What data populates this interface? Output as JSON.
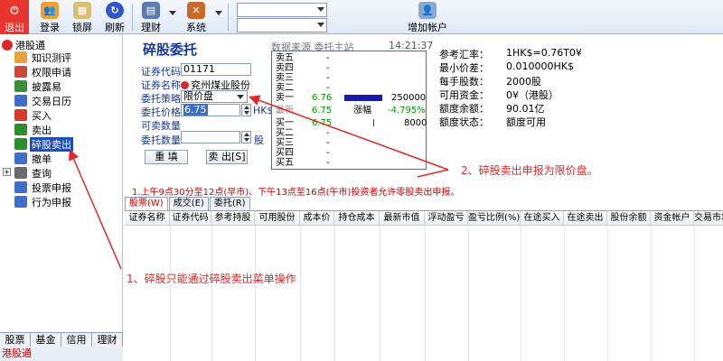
{
  "toolbar": {
    "exit": "退出",
    "login": "登录",
    "lock": "锁屏",
    "refresh": "刷新",
    "finance": "理财",
    "system": "系统",
    "add_account": "增加帐户"
  },
  "sidebar": {
    "root": "港股通",
    "items": [
      {
        "label": "知识测评",
        "color": "#e8a43c"
      },
      {
        "label": "权限申请",
        "color": "#c94a3b"
      },
      {
        "label": "披露易",
        "color": "#3b8f3b"
      },
      {
        "label": "交易日历",
        "color": "#3d6ec9"
      },
      {
        "label": "买入",
        "color": "#d63a2b"
      },
      {
        "label": "卖出",
        "color": "#2b8f2b"
      },
      {
        "label": "碎股卖出",
        "color": "#2b8f2b"
      },
      {
        "label": "撤单",
        "color": "#3d6ec9"
      },
      {
        "label": "查询",
        "color": "#6a6a6a"
      },
      {
        "label": "投票申报",
        "color": "#3d6ec9"
      },
      {
        "label": "行为申报",
        "color": "#3d6ec9"
      }
    ],
    "tabs": [
      "股票",
      "基金",
      "信用",
      "理财"
    ],
    "footer": "港股通"
  },
  "form": {
    "title": "碎股委托",
    "code_label": "证券代码",
    "code_value": "01171",
    "name_label": "证券名称",
    "name_value": "兖州煤业股份",
    "strategy_label": "委托策略",
    "strategy_value": "限价盘",
    "price_label": "委托价格",
    "price_value": "6.75",
    "price_unit": "HK$",
    "sellable_label": "可卖数量",
    "qty_label": "委托数量",
    "qty_unit": "股",
    "reset_btn": "重 填",
    "sell_btn": "卖 出[S]"
  },
  "quote": {
    "source_label": "数据来源",
    "source_value": "委托主站",
    "time": "14:21:37",
    "sell_labels": [
      "卖五",
      "卖四",
      "卖三",
      "卖二",
      "卖一"
    ],
    "sell_prices": [
      "-",
      "-",
      "-",
      "-",
      "6.76"
    ],
    "sell_qty": [
      "",
      "",
      "",
      "",
      "250000"
    ],
    "last_label": "最新",
    "last_price": "6.75",
    "change_label": "涨幅",
    "change_value": "-4.795%",
    "buy_labels": [
      "买一",
      "买二",
      "买三",
      "买四",
      "买五"
    ],
    "buy_prices": [
      "6.75",
      "-",
      "-",
      "-",
      "-"
    ],
    "buy_qty": [
      "8000",
      "",
      "",
      "",
      ""
    ]
  },
  "account": {
    "labels": [
      "参考汇率：",
      "最小价差：",
      "每手股数：",
      "可用资金：",
      "额度余额：",
      "额度状态："
    ],
    "values": [
      "1HK$=0.76T0¥",
      "0.010000HK$",
      "2000股",
      "0¥（港股）",
      "90.01亿",
      "额度可用"
    ]
  },
  "notice": "1.上午9点30分至12点(早市)、下午13点至16点(午市)投资者允许零股卖出申报。",
  "bottom_tabs": [
    "股票(W)",
    "成交(E)",
    "委托(R)"
  ],
  "grid_columns": [
    "证券名称",
    "证券代码",
    "参考持股",
    "可用股份",
    "成本价",
    "持仓成本",
    "最新市值",
    "浮动盈亏",
    "盈亏比例(%)",
    "在途买入",
    "在途卖出",
    "股份余额",
    "资金帐户",
    "交易市场"
  ],
  "annotations": {
    "a1": "1、碎股只能通过碎股卖出菜单操作",
    "a2": "2、碎股卖出申报为限价盘。"
  },
  "colors": {
    "accent": "#1a3a96",
    "selected": "#1c4fb8",
    "annotation": "#e02828",
    "exit": "#e8362e"
  }
}
